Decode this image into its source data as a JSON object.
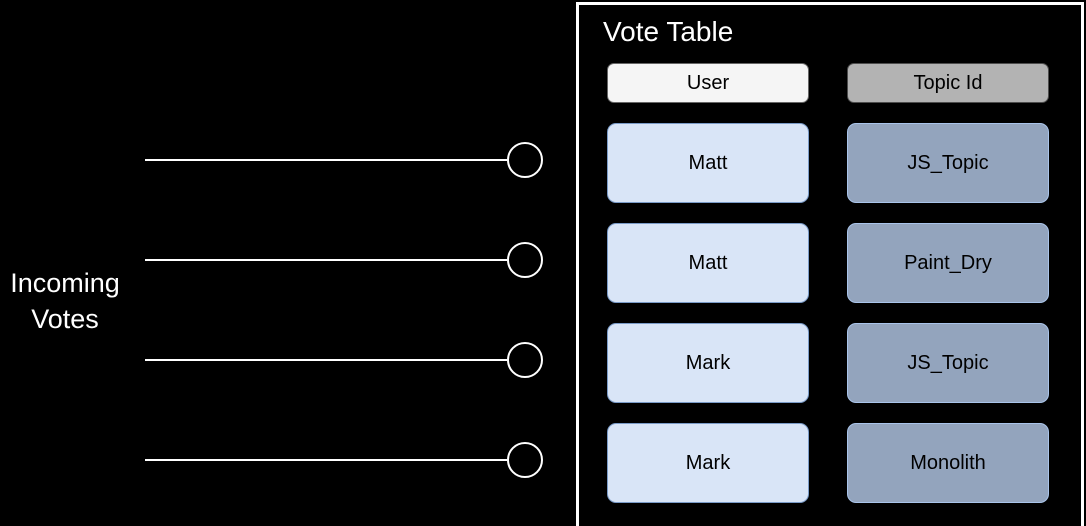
{
  "diagram": {
    "background_color": "#000000",
    "left_section": {
      "label": "Incoming\nVotes",
      "label_color": "#ffffff",
      "flow_count": 4,
      "node_icon": "circle-node-icon",
      "arrow_icon": "arrow-right-icon"
    },
    "panel": {
      "title": "Vote Table",
      "title_color": "#ffffff",
      "border_color": "#ffffff",
      "columns": [
        {
          "key": "user",
          "header": "User",
          "header_bg": "#f5f5f5",
          "cell_bg": "#d9e5f7"
        },
        {
          "key": "topic",
          "header": "Topic Id",
          "header_bg": "#b3b3b3",
          "cell_bg": "#93a4bd"
        }
      ],
      "rows": [
        {
          "user": "Matt",
          "topic": "JS_Topic"
        },
        {
          "user": "Matt",
          "topic": "Paint_Dry"
        },
        {
          "user": "Mark",
          "topic": "JS_Topic"
        },
        {
          "user": "Mark",
          "topic": "Monolith"
        }
      ]
    }
  }
}
